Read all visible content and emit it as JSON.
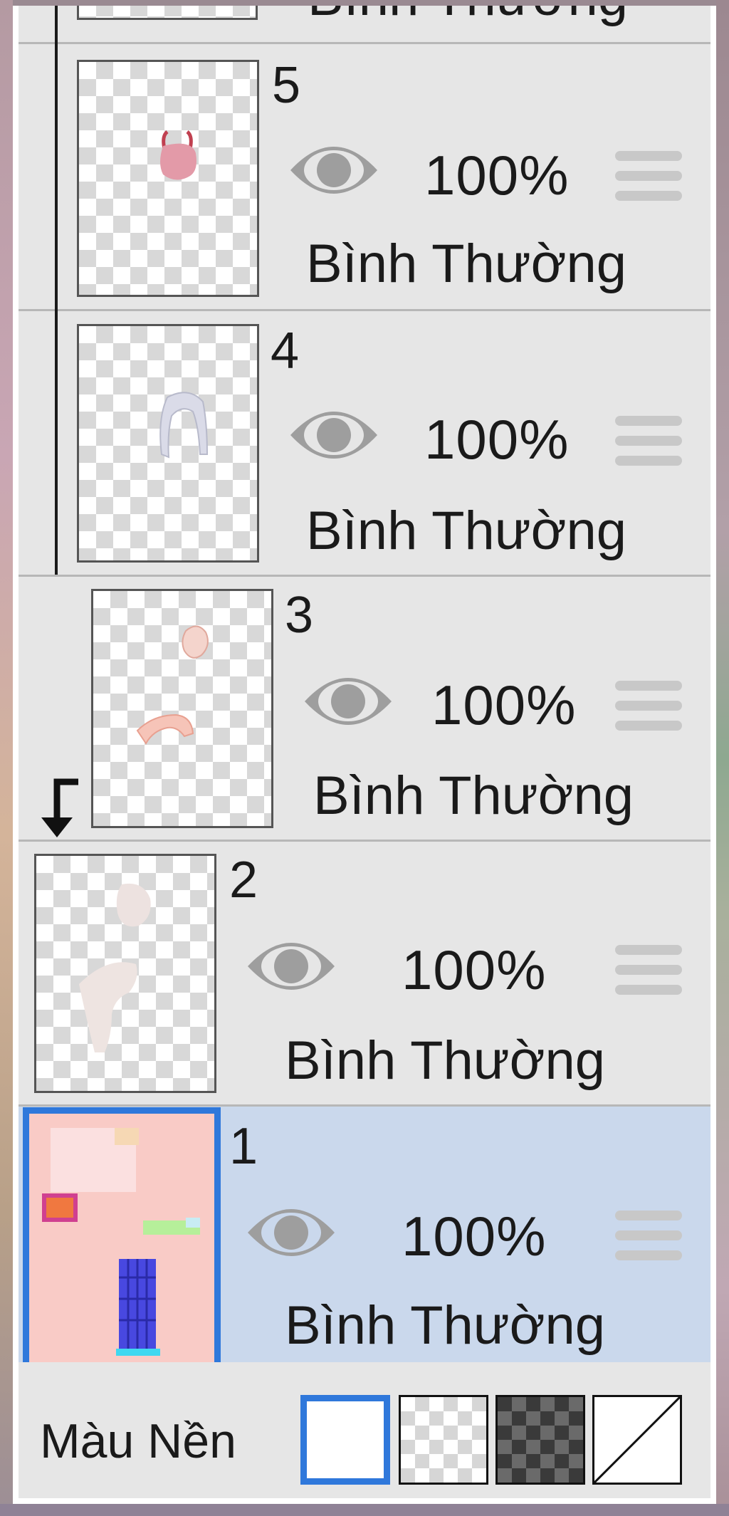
{
  "layers": [
    {
      "number": "",
      "opacity": "",
      "blend_mode": "Bình Thường",
      "selected": false
    },
    {
      "number": "5",
      "opacity": "100%",
      "blend_mode": "Bình Thường",
      "selected": false
    },
    {
      "number": "4",
      "opacity": "100%",
      "blend_mode": "Bình Thường",
      "selected": false
    },
    {
      "number": "3",
      "opacity": "100%",
      "blend_mode": "Bình Thường",
      "selected": false
    },
    {
      "number": "2",
      "opacity": "100%",
      "blend_mode": "Bình Thường",
      "selected": false
    },
    {
      "number": "1",
      "opacity": "100%",
      "blend_mode": "Bình Thường",
      "selected": true
    }
  ],
  "icons": {
    "visibility": "eye-icon",
    "reorder": "drag-handle-icon",
    "clipping": "clip-arrow-icon"
  },
  "background_bar": {
    "label": "Màu Nền",
    "options": [
      "white",
      "transparent-light",
      "transparent-dark",
      "none"
    ],
    "selected": "white"
  },
  "colors": {
    "accent": "#2f78db",
    "selected_row": "#cad8ec",
    "row": "#e6e6e6"
  }
}
